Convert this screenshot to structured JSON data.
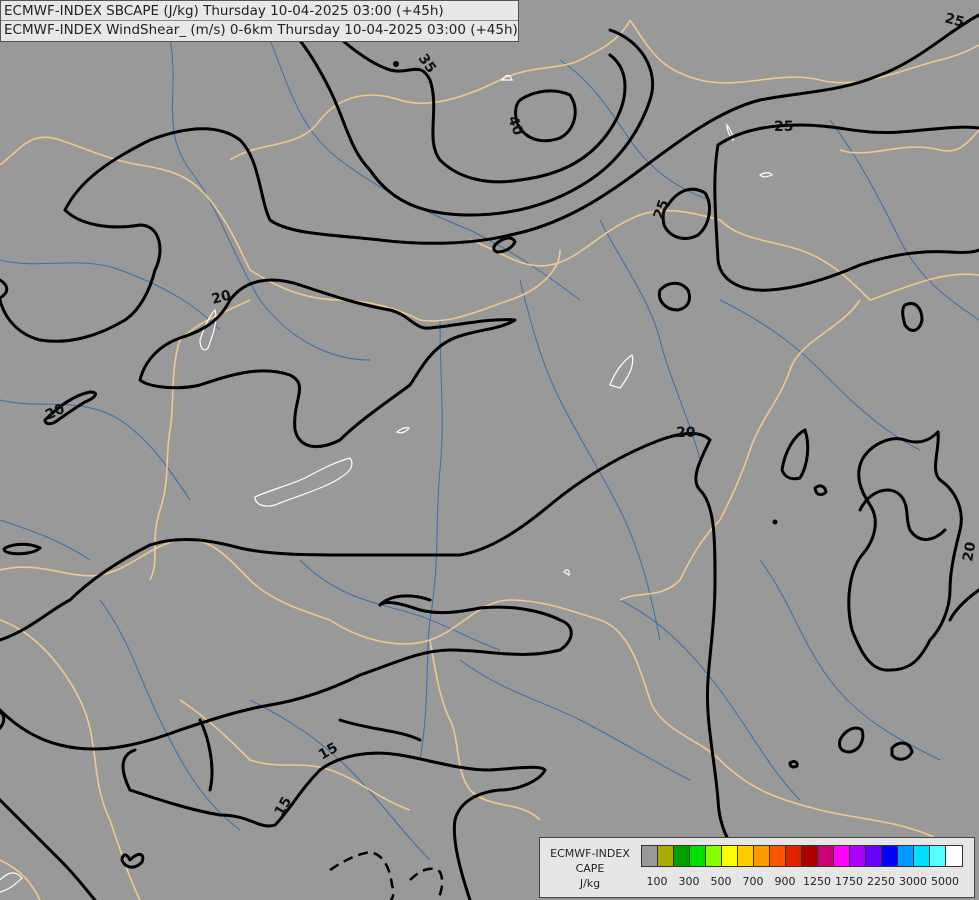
{
  "title_lines": [
    "ECMWF-INDEX SBCAPE (J/kg) Thursday 10-04-2025 03:00 (+45h)",
    "ECMWF-INDEX WindShear_ (m/s) 0-6km Thursday 10-04-2025 03:00 (+45h)"
  ],
  "contour_labels": [
    "25",
    "35",
    "40",
    "25",
    "25",
    "20",
    "20",
    "20",
    "20",
    "15",
    "15"
  ],
  "legend": {
    "line1": "ECMWF-INDEX",
    "line2": "CAPE",
    "line3": "J/kg",
    "colors": [
      "#999999",
      "#aaaa00",
      "#00a000",
      "#00e000",
      "#88ff00",
      "#ffff00",
      "#ffcc00",
      "#ff9900",
      "#ff5500",
      "#dd2200",
      "#aa0000",
      "#cc0077",
      "#ff00ff",
      "#aa00ff",
      "#6600ff",
      "#0000ff",
      "#0099ff",
      "#00ddff",
      "#55ffff",
      "#ffffff"
    ],
    "ticks": [
      "100",
      "300",
      "500",
      "700",
      "900",
      "1250",
      "1750",
      "2250",
      "3000",
      "5000"
    ]
  },
  "colors": {
    "background": "#999999",
    "border": "#f0c890",
    "river": "#3a6ea8",
    "contour": "#000000",
    "cape_outline": "#ffffff"
  }
}
